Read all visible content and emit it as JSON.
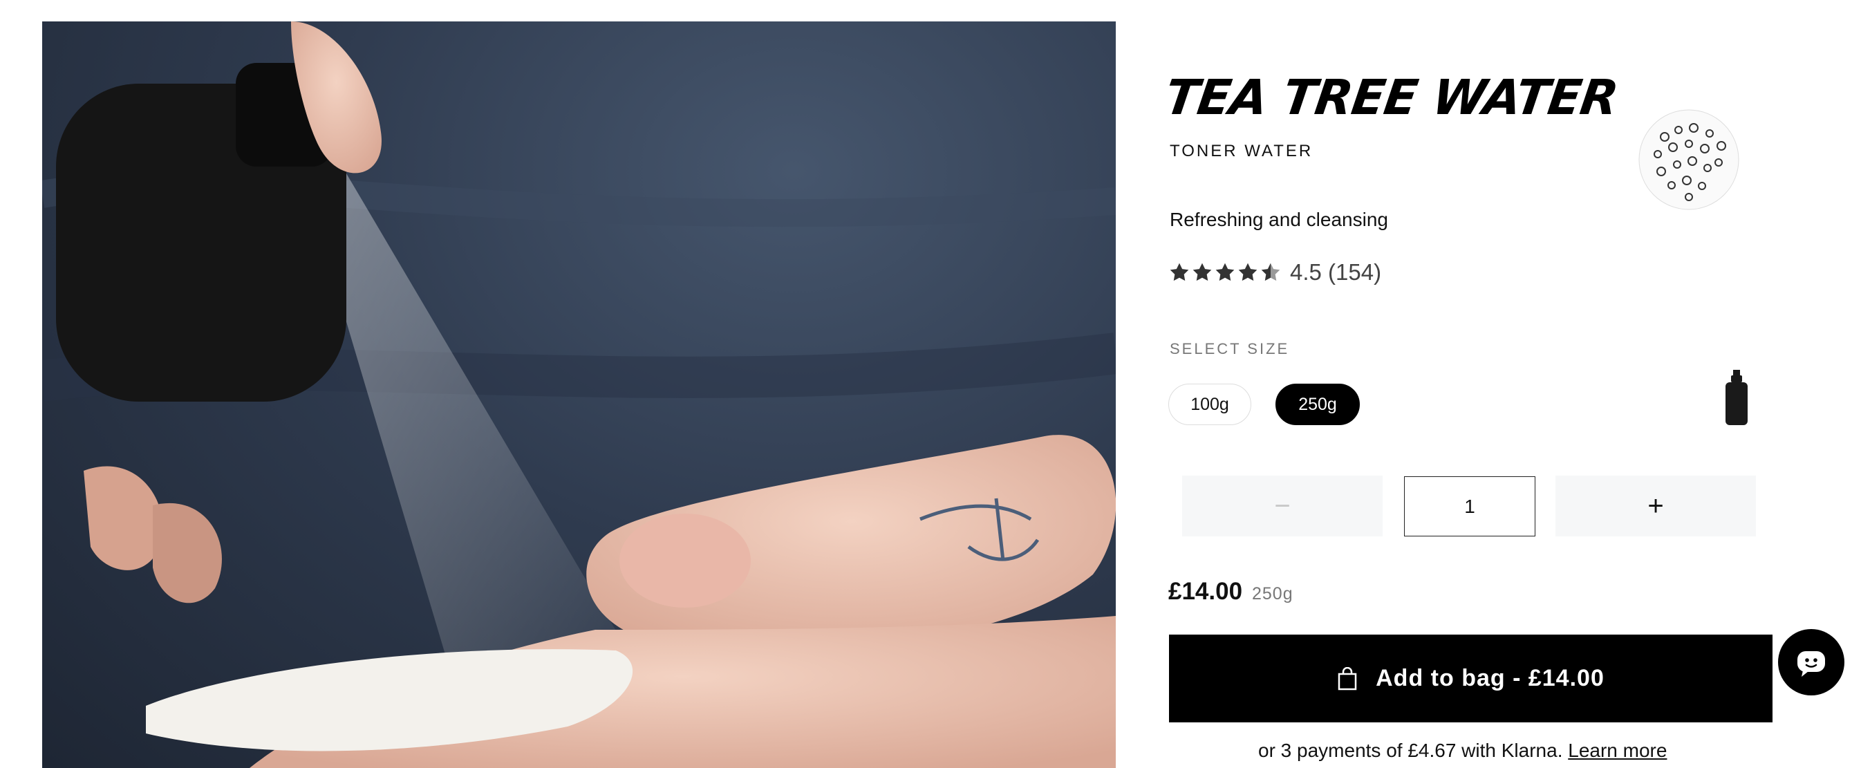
{
  "product": {
    "name": "TEA TREE WATER",
    "category": "TONER WATER",
    "tagline": "Refreshing and cleansing"
  },
  "rating": {
    "score": 4.5,
    "max": 5,
    "text": "4.5 (154)"
  },
  "size_selector": {
    "label": "SELECT SIZE",
    "options": [
      "100g",
      "250g"
    ],
    "selected": "250g"
  },
  "quantity": {
    "value": "1",
    "minus_symbol": "−",
    "plus_symbol": "+"
  },
  "price": {
    "amount": "£14.00",
    "size": "250g"
  },
  "add_to_bag": {
    "label": "Add to bag - £14.00"
  },
  "klarna": {
    "text": "or 3 payments of £4.67 with Klarna.",
    "link": "Learn more"
  },
  "icons": {
    "bag": "shopping-bag-icon",
    "chat": "chat-bot-icon",
    "bottle": "bottle-icon",
    "star": "star-icon"
  },
  "colors": {
    "primary": "#000000",
    "background": "#ffffff",
    "muted_text": "#777777",
    "qty_bg": "#f6f7f8",
    "photo_bg": "#2f3b4f"
  }
}
